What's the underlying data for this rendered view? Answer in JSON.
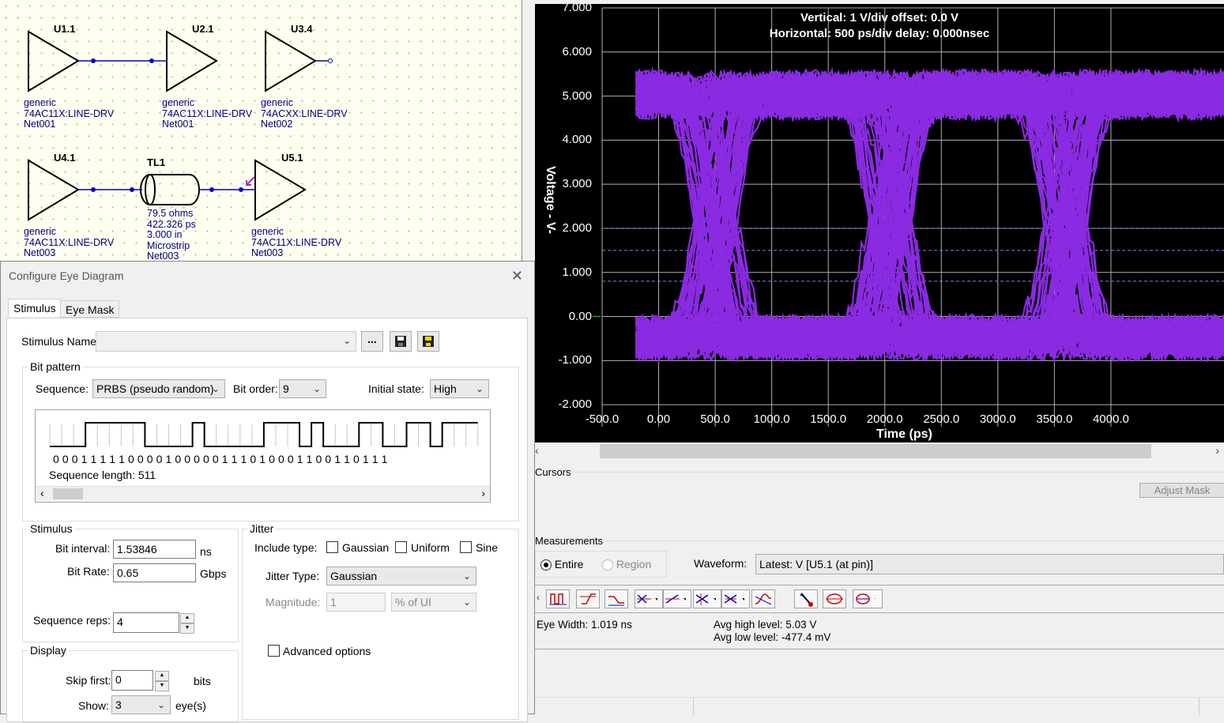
{
  "schematic": {
    "parts": [
      {
        "ref": "U1.1",
        "line1": "generic",
        "line2": "74AC11X:LINE-DRV",
        "line3": "Net001"
      },
      {
        "ref": "U2.1",
        "line1": "generic",
        "line2": "74AC11X:LINE-DRV",
        "line3": "Net001"
      },
      {
        "ref": "U3.4",
        "line1": "generic",
        "line2": "74ACXX:LINE-DRV",
        "line3": "Net002"
      },
      {
        "ref": "U4.1",
        "line1": "generic",
        "line2": "74AC11X:LINE-DRV",
        "line3": "Net003"
      },
      {
        "ref": "U5.1",
        "line1": "generic",
        "line2": "74AC11X:LINE-DRV",
        "line3": "Net003"
      }
    ],
    "tline": {
      "ref": "TL1",
      "impedance": "79.5 ohms",
      "delay": "422.326 ps",
      "length": "3.000 in",
      "type": "Microstrip",
      "net": "Net003"
    }
  },
  "scope": {
    "title_vertical": "Vertical: 1  V/div  offset: 0.0 V",
    "title_horizontal": "Horizontal: 500 ps/div  delay: 0.000nsec",
    "ylabel": "Voltage  - V-",
    "xlabel": "Time  (ps)",
    "yticks": [
      "7.000",
      "6.000",
      "5.000",
      "4.000",
      "3.000",
      "2.000",
      "1.000",
      "0.00",
      "-1.000",
      "-2.000"
    ],
    "xticks": [
      "-500.0",
      "0.00",
      "500.0",
      "1000.0",
      "1500.0",
      "2000.0",
      "2500.0",
      "3000.0",
      "3500.0",
      "4000.0"
    ],
    "trace_color": "#8a2be2"
  },
  "chart_data": {
    "type": "line",
    "title": "Vertical: 1  V/div  offset: 0.0 V",
    "subtitle": "Horizontal: 500 ps/div  delay: 0.000nsec",
    "xlabel": "Time  (ps)",
    "ylabel": "Voltage  - V-",
    "xlim": [
      -500,
      5000
    ],
    "ylim": [
      -2.5,
      7.0
    ],
    "high_level_v": 5.03,
    "low_level_v": -0.4774,
    "bit_interval_ps": 1538.46,
    "crossing_times_ps": [
      500,
      2050,
      3600
    ],
    "threshold_lines_v": [
      2.0,
      1.5,
      0.8
    ]
  },
  "cursors": {
    "label": "Cursors",
    "adjust_mask": "Adjust Mask"
  },
  "measurements": {
    "label": "Measurements",
    "entire": "Entire",
    "region": "Region",
    "waveform_label": "Waveform:",
    "waveform_value": "Latest: V [U5.1 (at pin)]",
    "eye_width": "Eye Width: 1.019 ns",
    "avg_high": "Avg high level: 5.03 V",
    "avg_low": "Avg low level: -477.4 mV"
  },
  "dialog": {
    "title": "Configure Eye Diagram",
    "tabs": [
      "Stimulus",
      "Eye Mask"
    ],
    "stimulus_name_label": "Stimulus Name:",
    "stimulus_name_value": "",
    "ellipsis": "...",
    "bit_pattern": {
      "legend": "Bit pattern",
      "sequence_label": "Sequence:",
      "sequence_value": "PRBS (pseudo random)",
      "bit_order_label": "Bit order:",
      "bit_order_value": "9",
      "initial_state_label": "Initial state:",
      "initial_state_value": "High",
      "bits": "0 0 0 1 1 1 1 1 0 0 0 0 1 0 0 0 0 0 1 1 1 0 1 0 0 0 1 1 0 0 1 1 0 1 1 1",
      "sequence_length": "Sequence length: 511"
    },
    "stimulus": {
      "legend": "Stimulus",
      "bit_interval_label": "Bit interval:",
      "bit_interval_value": "1.53846",
      "bit_interval_unit": "ns",
      "bit_rate_label": "Bit Rate:",
      "bit_rate_value": "0.65",
      "bit_rate_unit": "Gbps",
      "seq_reps_label": "Sequence reps:",
      "seq_reps_value": "4"
    },
    "jitter": {
      "legend": "Jitter",
      "include_label": "Include type:",
      "gaussian": "Gaussian",
      "uniform": "Uniform",
      "sine": "Sine",
      "type_label": "Jitter Type:",
      "type_value": "Gaussian",
      "magnitude_label": "Magnitude:",
      "magnitude_value": "1",
      "magnitude_unit": "% of UI",
      "advanced": "Advanced options"
    },
    "display": {
      "legend": "Display",
      "skip_label": "Skip first:",
      "skip_value": "0",
      "skip_unit": "bits",
      "show_label": "Show:",
      "show_value": "3",
      "show_unit": "eye(s)"
    }
  }
}
